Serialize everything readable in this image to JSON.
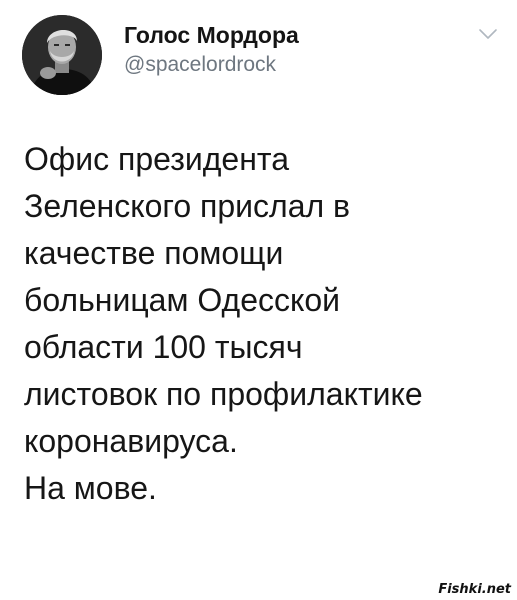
{
  "tweet": {
    "author_name": "Голос Мордора",
    "author_handle": "@spacelordrock",
    "avatar_icon": "user-photo-avatar",
    "menu_icon": "chevron-down-icon",
    "lines": [
      "Офис президента",
      "Зеленского прислал в",
      "качестве помощи",
      "больницам Одесской",
      "области 100 тысяч",
      "листовок по профилактике",
      "коронавируса.",
      "На мове."
    ]
  },
  "watermark": "Fishki.net",
  "colors": {
    "text": "#161616",
    "handle": "#6e7780",
    "chevron": "#b0b8c0",
    "background": "#ffffff"
  }
}
